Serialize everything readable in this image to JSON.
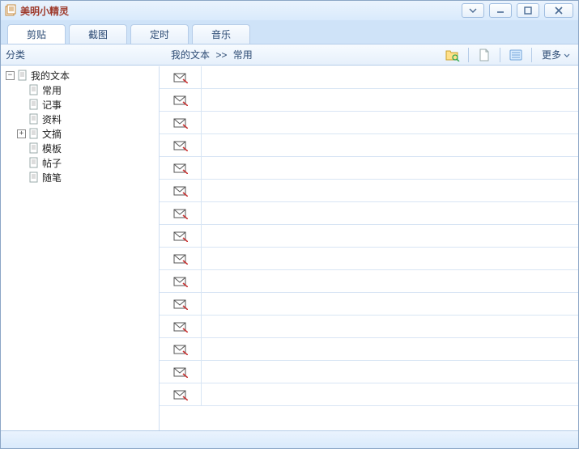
{
  "window": {
    "title": "美明小精灵"
  },
  "tabs": [
    {
      "label": "剪贴",
      "active": true
    },
    {
      "label": "截图",
      "active": false
    },
    {
      "label": "定时",
      "active": false
    },
    {
      "label": "音乐",
      "active": false
    }
  ],
  "toolbar": {
    "category_label": "分类",
    "breadcrumb_root": "我的文本",
    "breadcrumb_sep": ">>",
    "breadcrumb_leaf": "常用",
    "more_label": "更多"
  },
  "tree": {
    "root": {
      "label": "我的文本",
      "expanded": true,
      "children": [
        {
          "label": "常用",
          "expandable": false
        },
        {
          "label": "记事",
          "expandable": false
        },
        {
          "label": "资料",
          "expandable": false
        },
        {
          "label": "文摘",
          "expandable": true,
          "expanded": false
        },
        {
          "label": "模板",
          "expandable": false
        },
        {
          "label": "帖子",
          "expandable": false
        },
        {
          "label": "随笔",
          "expandable": false
        }
      ]
    }
  },
  "list": {
    "row_count": 15
  }
}
